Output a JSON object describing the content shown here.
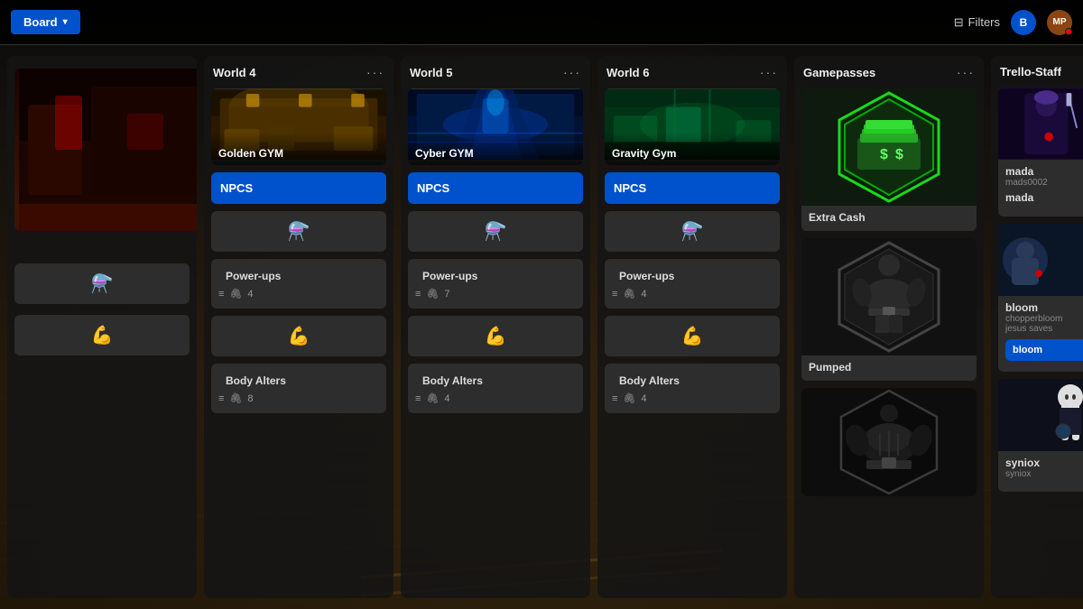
{
  "topbar": {
    "board_label": "Board",
    "filters_label": "Filters",
    "avatar_b": "B",
    "avatar_mp": "MP"
  },
  "columns": [
    {
      "id": "col0",
      "title": "",
      "show_title": false,
      "cards": [
        {
          "type": "image_bg",
          "bg": "gym_dark_red",
          "height": 180
        }
      ]
    },
    {
      "id": "col1",
      "title": "World 4",
      "cards": [
        {
          "type": "image_title",
          "bg": "golden",
          "title": "Golden GYM"
        },
        {
          "type": "blue_label",
          "label": "NPCS"
        },
        {
          "type": "icon_only",
          "icon": "⚗️"
        },
        {
          "type": "titled_meta",
          "title": "Power-ups",
          "meta_icon": "≡",
          "meta_clip": "🖇",
          "count": 4
        },
        {
          "type": "icon_only",
          "icon": "💪"
        },
        {
          "type": "titled_meta",
          "title": "Body Alters",
          "meta_icon": "≡",
          "meta_clip": "🖇",
          "count": 8
        }
      ]
    },
    {
      "id": "col2",
      "title": "World 5",
      "cards": [
        {
          "type": "image_title",
          "bg": "cyber",
          "title": "Cyber GYM"
        },
        {
          "type": "blue_label",
          "label": "NPCS"
        },
        {
          "type": "icon_only",
          "icon": "⚗️"
        },
        {
          "type": "titled_meta",
          "title": "Power-ups",
          "meta_icon": "≡",
          "meta_clip": "🖇",
          "count": 7
        },
        {
          "type": "icon_only",
          "icon": "💪"
        },
        {
          "type": "titled_meta",
          "title": "Body Alters",
          "meta_icon": "≡",
          "meta_clip": "🖇",
          "count": 4
        }
      ]
    },
    {
      "id": "col3",
      "title": "World 6",
      "cards": [
        {
          "type": "image_title",
          "bg": "gravity",
          "title": "Gravity Gym"
        },
        {
          "type": "blue_label",
          "label": "NPCS"
        },
        {
          "type": "icon_only",
          "icon": "⚗️"
        },
        {
          "type": "titled_meta",
          "title": "Power-ups",
          "meta_icon": "≡",
          "meta_clip": "🖇",
          "count": 4
        },
        {
          "type": "icon_only",
          "icon": "💪"
        },
        {
          "type": "titled_meta",
          "title": "Body Alters",
          "meta_icon": "≡",
          "meta_clip": "🖇",
          "count": 4
        }
      ]
    },
    {
      "id": "col4",
      "title": "Gamepasses",
      "cards": [
        {
          "type": "gamepass_money",
          "title": "Extra Cash"
        },
        {
          "type": "gamepass_muscle",
          "title": "Pumped"
        },
        {
          "type": "gamepass_muscle2",
          "title": ""
        }
      ]
    },
    {
      "id": "col5",
      "title": "Trello-Staff",
      "staff": [
        {
          "name": "mada",
          "username": "mads0002",
          "display": "mada",
          "badges": [
            "#7c3aed",
            "#6366f1",
            "#10b981",
            "#f59e0b"
          ],
          "has_avatar": true,
          "avatar_color": "#4a1a5e",
          "avatar_icon": "🧝"
        },
        {
          "name": "bloom",
          "username": "chopperbloom",
          "sub": "jesus saves",
          "display": "bloom",
          "has_avatar": true,
          "avatar_color": "#1a3a5e",
          "avatar_icon": "👤",
          "badge_colors": [
            "#ef4444",
            "#10b981",
            "#f59e0b"
          ],
          "is_blue": true
        },
        {
          "name": "syniox",
          "username": "syniox",
          "display": "syniox",
          "has_avatar": true,
          "avatar_color": "#1a2a1a",
          "avatar_icon": "🧝‍♀️",
          "badge_colors": [
            "#10b981",
            "#f59e0b"
          ]
        }
      ]
    }
  ],
  "icons": {
    "menu_dots": "···",
    "chevron_down": "▾",
    "filter": "⊟"
  }
}
